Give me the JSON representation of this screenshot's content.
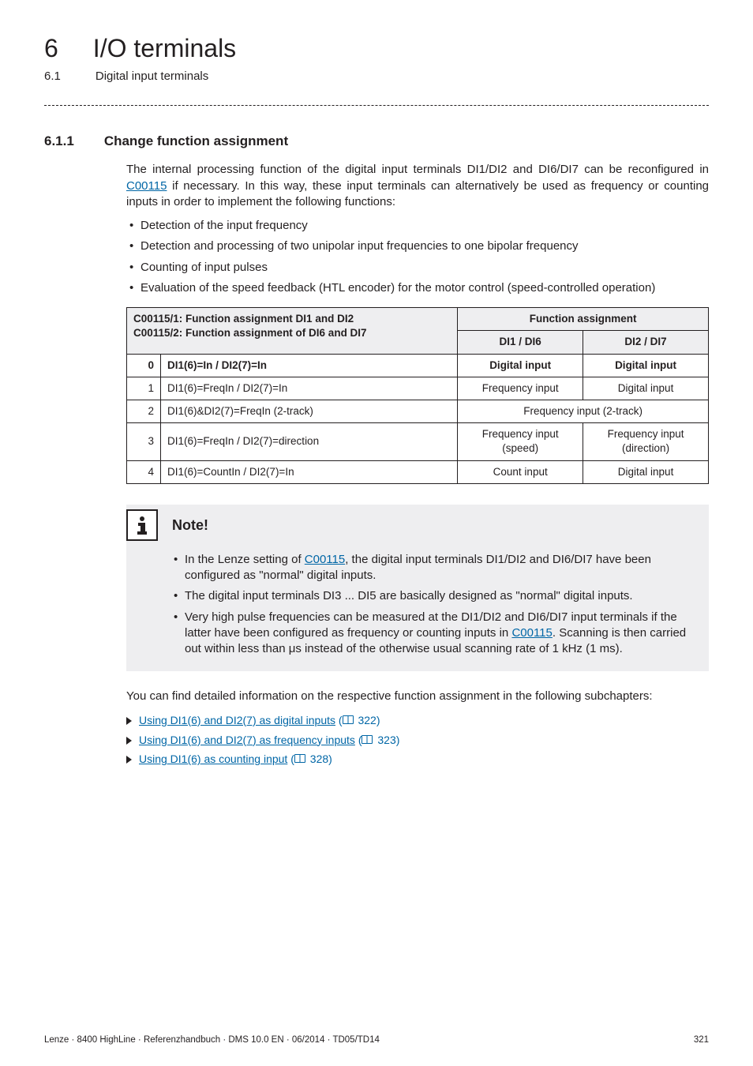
{
  "header": {
    "chapter_number": "6",
    "chapter_title": "I/O terminals",
    "section_number": "6.1",
    "section_title": "Digital input terminals"
  },
  "section": {
    "number": "6.1.1",
    "title": "Change function assignment"
  },
  "intro": {
    "p1_a": "The internal processing function of the digital input terminals DI1/DI2 and DI6/DI7 can be reconfigured in ",
    "p1_link": "C00115",
    "p1_b": " if necessary. In this way, these input terminals can alternatively be used as frequency or counting inputs in order to implement the following functions:",
    "bullets": [
      "Detection of the input frequency",
      "Detection and processing of two unipolar input frequencies to one bipolar frequency",
      "Counting of input pulses",
      "Evaluation of the speed feedback (HTL encoder) for the motor control (speed-controlled operation)"
    ]
  },
  "table": {
    "left_header_1": "C00115/1: Function assignment DI1 and DI2",
    "left_header_2": "C00115/2: Function assignment of DI6 and DI7",
    "right_header": "Function assignment",
    "col_di1": "DI1 / DI6",
    "col_di2": "DI2 / DI7",
    "rows": [
      {
        "idx": "0",
        "label": "DI1(6)=In / DI2(7)=In",
        "c1": "Digital input",
        "c2": "Digital input",
        "span": false,
        "bold": true
      },
      {
        "idx": "1",
        "label": "DI1(6)=FreqIn / DI2(7)=In",
        "c1": "Frequency input",
        "c2": "Digital input",
        "span": false,
        "bold": false
      },
      {
        "idx": "2",
        "label": "DI1(6)&DI2(7)=FreqIn (2-track)",
        "c1": "Frequency input (2-track)",
        "c2": "",
        "span": true,
        "bold": false
      },
      {
        "idx": "3",
        "label": "DI1(6)=FreqIn / DI2(7)=direction",
        "c1": "Frequency input\n(speed)",
        "c2": "Frequency input\n(direction)",
        "span": false,
        "bold": false
      },
      {
        "idx": "4",
        "label": "DI1(6)=CountIn / DI2(7)=In",
        "c1": "Count input",
        "c2": "Digital input",
        "span": false,
        "bold": false
      }
    ]
  },
  "note": {
    "label": "Note!",
    "b1_a": "In the Lenze setting of ",
    "b1_link": "C00115",
    "b1_b": ", the digital input terminals DI1/DI2 and DI6/DI7 have been configured as \"normal\" digital inputs.",
    "b2": "The digital input terminals DI3 ... DI5 are basically designed as  \"normal\" digital inputs.",
    "b3_a": "Very high pulse frequencies can be measured at the DI1/DI2 and DI6/DI7 input terminals if the latter have been configured as frequency or counting inputs in ",
    "b3_link": "C00115",
    "b3_b": ". Scanning is then carried out within less than μs instead of the otherwise usual scanning rate of 1 kHz (1 ms)."
  },
  "after": {
    "lead": "You can find detailed information on the respective function assignment in the following subchapters:",
    "items": [
      {
        "text": "Using DI1(6) and DI2(7) as digital inputs",
        "page": "322"
      },
      {
        "text": "Using DI1(6) and DI2(7) as frequency inputs",
        "page": "323"
      },
      {
        "text": "Using DI1(6) as counting input",
        "page": "328"
      }
    ]
  },
  "footer": {
    "left": "Lenze · 8400 HighLine · Referenzhandbuch · DMS 10.0 EN · 06/2014 · TD05/TD14",
    "right": "321"
  }
}
